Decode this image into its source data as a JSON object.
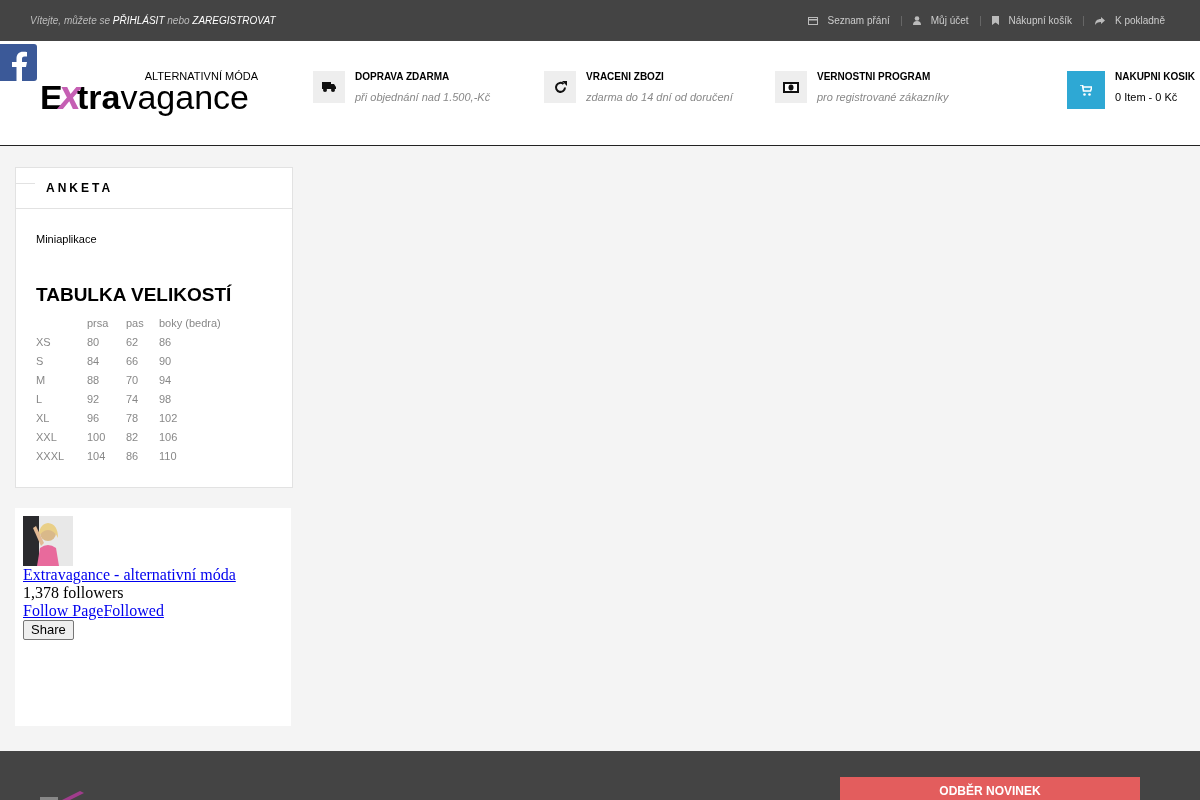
{
  "top_bar": {
    "welcome": "Vítejte, můžete se **PŘIHLÁSIT** nebo **ZAREGISTROVAT**",
    "links": [
      {
        "kind": "wishlist",
        "label": "Seznam přání"
      },
      {
        "kind": "account",
        "label": "Můj účet"
      },
      {
        "kind": "bookmark",
        "label": "Nákupní košík"
      },
      {
        "kind": "share",
        "label": "K pokladně"
      }
    ]
  },
  "header": {
    "logo": {
      "tagline": "ALTERNATIVNÍ MÓDA",
      "name_dark": "E",
      "name_x": "x",
      "name_bold": "tra",
      "name_light": "vagance"
    },
    "features": [
      {
        "kind": "truck",
        "title": "DOPRAVA ZDARMA",
        "subtitle": "při objednání nad 1.500,-Kč"
      },
      {
        "kind": "refresh",
        "title": "VRACENI ZBOZI",
        "subtitle": "zdarma do 14 dní od doručení"
      },
      {
        "kind": "money",
        "title": "VERNOSTNI PROGRAM",
        "subtitle": "pro registrované zákazníky"
      }
    ],
    "cart": {
      "title": "NAKUPNI KOSIK",
      "summary": "0 Item - 0 Kč"
    }
  },
  "sidebar": {
    "poll": {
      "title": "ANKETA",
      "widget_label": "Miniaplikace",
      "size_table": {
        "title": "TABULKA VELIKOSTÍ",
        "columns": [
          "",
          "prsa",
          "pas",
          "boky (bedra)"
        ],
        "rows": [
          [
            "XS",
            "80",
            "62",
            "86"
          ],
          [
            "S",
            "84",
            "66",
            "90"
          ],
          [
            "M",
            "88",
            "70",
            "94"
          ],
          [
            "L",
            "92",
            "74",
            "98"
          ],
          [
            "XL",
            "96",
            "78",
            "102"
          ],
          [
            "XXL",
            "100",
            "82",
            "106"
          ],
          [
            "XXXL",
            "104",
            "86",
            "110"
          ]
        ]
      }
    },
    "facebook": {
      "page_name": "Extravagance - alternativní móda",
      "followers": "1,378 followers",
      "follow_link": "Follow Page",
      "followed_link": "Followed",
      "share_button": "Share"
    }
  },
  "footer": {
    "newsletter_title": "ODBĚR NOVINEK"
  }
}
